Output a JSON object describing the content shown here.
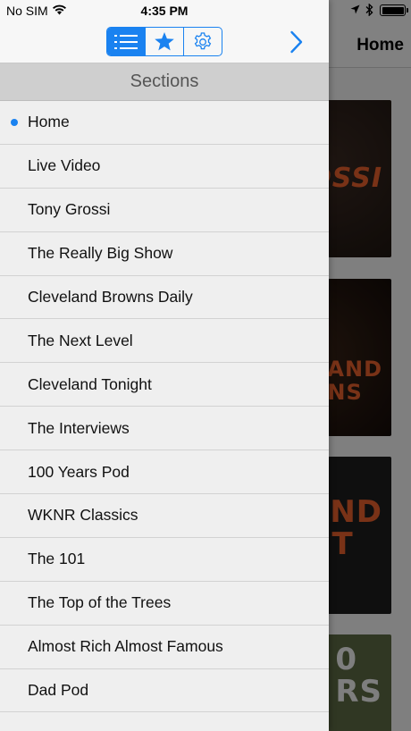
{
  "status_bar": {
    "carrier": "No SIM",
    "time": "4:35 PM"
  },
  "background_app": {
    "title": "Home",
    "tiles": [
      "OSSI",
      "AND\nNS",
      "AND\nHT",
      "0\nRS"
    ]
  },
  "drawer": {
    "tabs": [
      {
        "icon": "list-icon",
        "active": true
      },
      {
        "icon": "star-icon",
        "active": false
      },
      {
        "icon": "gear-icon",
        "active": false
      }
    ],
    "header": "Sections",
    "selected_index": 0,
    "items": [
      {
        "label": "Home"
      },
      {
        "label": "Live Video"
      },
      {
        "label": "Tony Grossi"
      },
      {
        "label": "The Really Big Show"
      },
      {
        "label": "Cleveland Browns Daily"
      },
      {
        "label": "The Next Level"
      },
      {
        "label": "Cleveland Tonight"
      },
      {
        "label": "The Interviews"
      },
      {
        "label": "100 Years Pod"
      },
      {
        "label": "WKNR Classics"
      },
      {
        "label": "The 101"
      },
      {
        "label": "The Top of the Trees"
      },
      {
        "label": "Almost Rich Almost Famous"
      },
      {
        "label": "Dad Pod"
      }
    ]
  },
  "colors": {
    "accent": "#1a82f0",
    "drawer_bg": "#efefef",
    "header_bg": "#cfcfcf"
  }
}
